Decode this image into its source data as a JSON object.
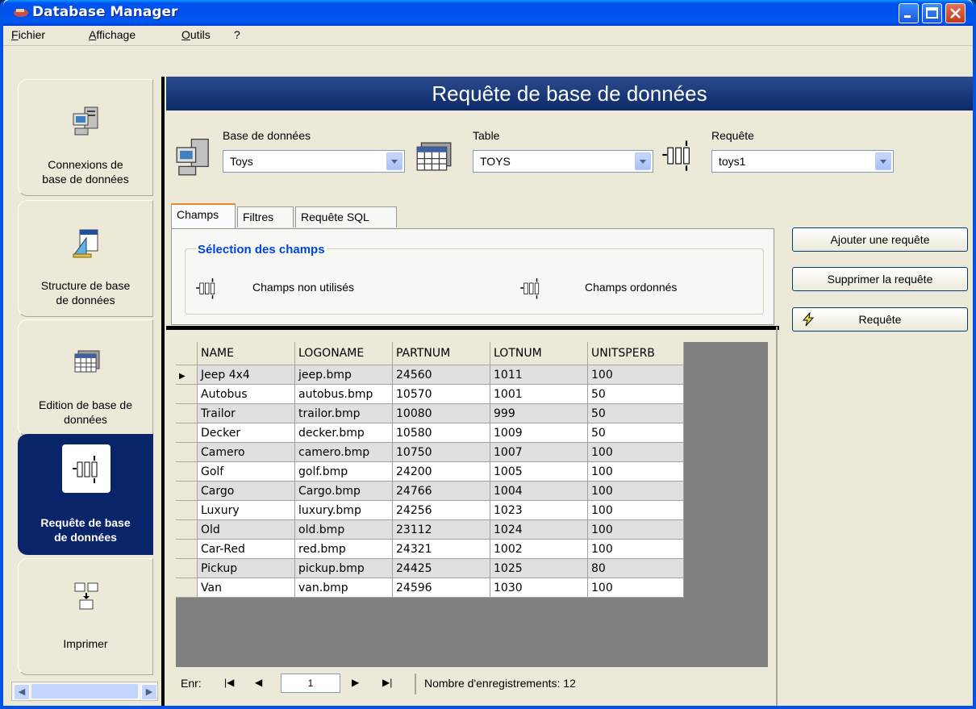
{
  "window": {
    "title": "Database Manager"
  },
  "menu": {
    "items": [
      {
        "label": "Fichier",
        "ul": "F",
        "rest": "ichier"
      },
      {
        "label": "Affichage",
        "ul": "A",
        "rest": "ffichage"
      },
      {
        "label": "Outils",
        "ul": "O",
        "rest": "utils"
      },
      {
        "label": "?",
        "ul": "",
        "rest": "?"
      }
    ]
  },
  "sidebar": {
    "items": [
      {
        "line1": "Connexions de",
        "line2": "base de données",
        "icon": "server-icon"
      },
      {
        "line1": "Structure de base",
        "line2": "de données",
        "icon": "design-tools-icon"
      },
      {
        "line1": "Edition de base de",
        "line2": "données",
        "icon": "table-grid-icon"
      },
      {
        "line1": "Requête de base",
        "line2": "de données",
        "icon": "query-icon",
        "active": true
      },
      {
        "line1": "Imprimer",
        "line2": "",
        "icon": "print-report-icon"
      }
    ]
  },
  "main": {
    "header": "Requête de base de données",
    "database": {
      "label": "Base de données",
      "value": "Toys"
    },
    "table": {
      "label": "Table",
      "value": "TOYS"
    },
    "query": {
      "label": "Requête",
      "value": "toys1"
    },
    "tabs": [
      "Champs",
      "Filtres",
      "Requête SQL"
    ],
    "group_title": "Sélection des champs",
    "unused_fields": "Champs non utilisés",
    "ordered_fields": "Champs ordonnés",
    "buttons": {
      "add": "Ajouter une requête",
      "delete": "Supprimer la requête",
      "run": "Requête"
    }
  },
  "grid": {
    "columns": [
      "NAME",
      "LOGONAME",
      "PARTNUM",
      "LOTNUM",
      "UNITSPERB"
    ],
    "rows": [
      [
        "Jeep 4x4",
        "jeep.bmp",
        "24560",
        "1011",
        "100"
      ],
      [
        "Autobus",
        "autobus.bmp",
        "10570",
        "1001",
        "50"
      ],
      [
        "Trailor",
        "trailor.bmp",
        "10080",
        "999",
        "50"
      ],
      [
        "Decker",
        "decker.bmp",
        "10580",
        "1009",
        "50"
      ],
      [
        "Camero",
        "camero.bmp",
        "10750",
        "1007",
        "100"
      ],
      [
        "Golf",
        "golf.bmp",
        "24200",
        "1005",
        "100"
      ],
      [
        "Cargo",
        "Cargo.bmp",
        "24766",
        "1004",
        "100"
      ],
      [
        "Luxury",
        "luxury.bmp",
        "24256",
        "1023",
        "100"
      ],
      [
        "Old",
        "old.bmp",
        "23112",
        "1024",
        "100"
      ],
      [
        "Car-Red",
        "red.bmp",
        "24321",
        "1002",
        "100"
      ],
      [
        "Pickup",
        "pickup.bmp",
        "24425",
        "1025",
        "80"
      ],
      [
        "Van",
        "van.bmp",
        "24596",
        "1030",
        "100"
      ]
    ],
    "current_row": 0
  },
  "navigator": {
    "label": "Enr:",
    "record": "1",
    "count_text": "Nombre d'enregistrements: 12"
  }
}
